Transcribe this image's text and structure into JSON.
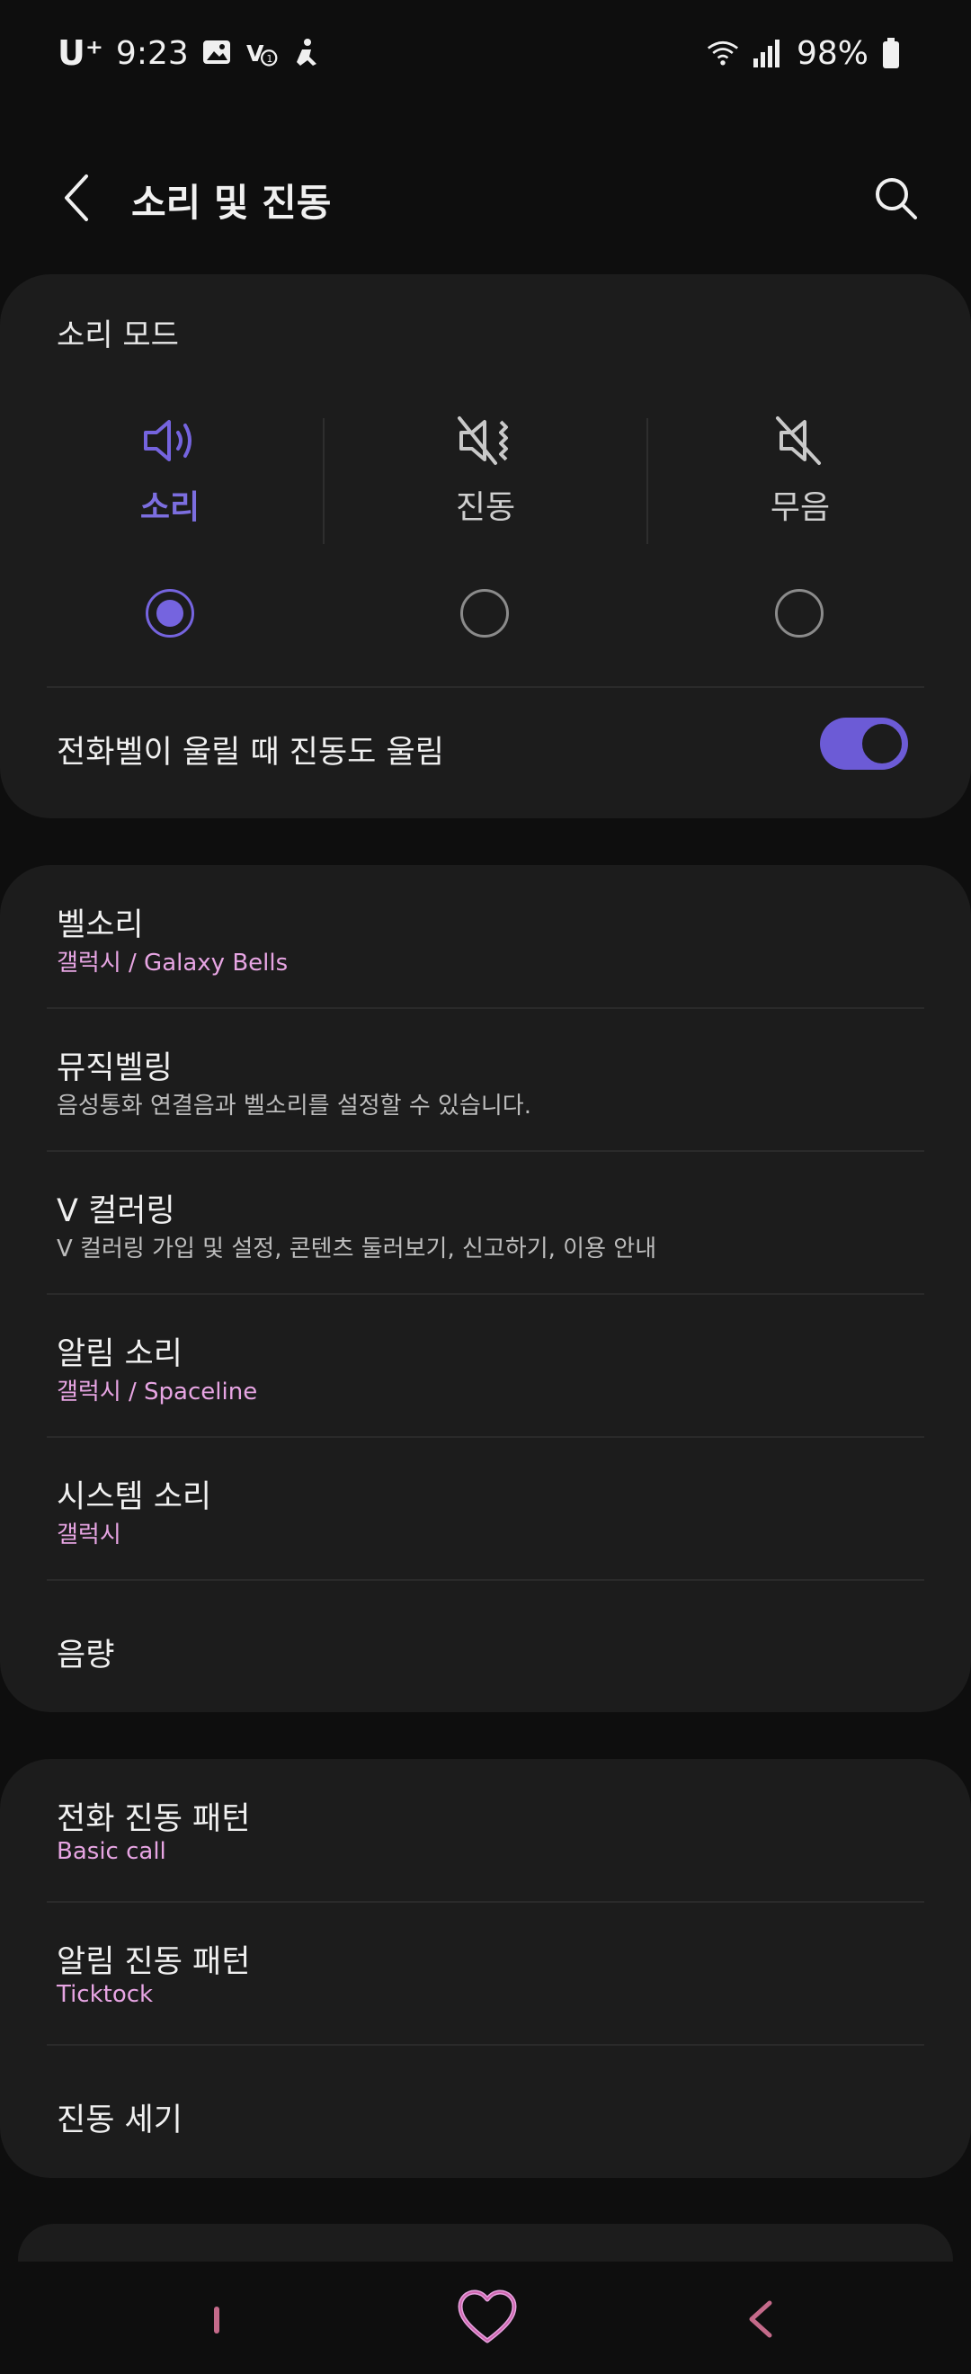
{
  "status_bar": {
    "carrier": "U⁺",
    "time": "9:23",
    "battery": "98%"
  },
  "app_bar": {
    "title": "소리 및 진동"
  },
  "sound_mode": {
    "section_title": "소리 모드",
    "modes": [
      {
        "label": "소리",
        "icon": "speaker-icon",
        "selected": true
      },
      {
        "label": "진동",
        "icon": "vibrate-icon",
        "selected": false
      },
      {
        "label": "무음",
        "icon": "mute-icon",
        "selected": false
      }
    ],
    "vibrate_while_ringing": {
      "label": "전화벨이 울릴 때 진동도 울림",
      "enabled": true
    }
  },
  "ring_settings": [
    {
      "title": "벨소리",
      "subtitle": "갤럭시 / Galaxy Bells",
      "subtitle_style": "accent"
    },
    {
      "title": "뮤직벨링",
      "subtitle": "음성통화 연결음과 벨소리를 설정할 수 있습니다.",
      "subtitle_style": "muted"
    },
    {
      "title": "V 컬러링",
      "subtitle": "V 컬러링 가입 및 설정, 콘텐츠 둘러보기, 신고하기, 이용 안내",
      "subtitle_style": "muted"
    },
    {
      "title": "알림 소리",
      "subtitle": "갤럭시 / Spaceline",
      "subtitle_style": "accent"
    },
    {
      "title": "시스템 소리",
      "subtitle": "갤럭시",
      "subtitle_style": "accent"
    },
    {
      "title": "음량",
      "subtitle": "",
      "subtitle_style": "none"
    }
  ],
  "vibration_settings": [
    {
      "title": "전화 진동 패턴",
      "subtitle": "Basic call",
      "subtitle_style": "accent"
    },
    {
      "title": "알림 진동 패턴",
      "subtitle": "Ticktock",
      "subtitle_style": "accent"
    },
    {
      "title": "진동 세기",
      "subtitle": "",
      "subtitle_style": "none"
    }
  ],
  "colors": {
    "accent_purple": "#7564df",
    "subtitle_pink": "#e7a5e3",
    "card_bg": "#1c1c1c",
    "page_bg": "#0e0e0e",
    "nav_pink": "#c46a8a"
  }
}
